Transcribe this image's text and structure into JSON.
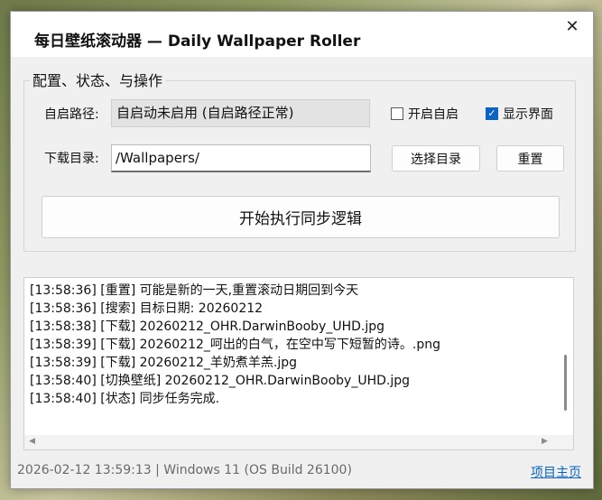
{
  "window": {
    "title": "每日壁纸滚动器 — Daily Wallpaper Roller",
    "close_glyph": "✕"
  },
  "config_group": {
    "title": "配置、状态、与操作",
    "autostart_label": "自启路径:",
    "autostart_value": "自启动未启用 (自启路径正常)",
    "enable_autostart": {
      "label": "开启自启",
      "checked": false
    },
    "show_ui": {
      "label": "显示界面",
      "checked": true
    },
    "download_label": "下载目录:",
    "download_value": "/Wallpapers/",
    "choose_dir_button": "选择目录",
    "reset_button": "重置",
    "run_button": "开始执行同步逻辑"
  },
  "log": {
    "lines": [
      "[13:58:36] [重置] 可能是新的一天,重置滚动日期回到今天",
      "[13:58:36] [搜索] 目标日期: 20260212",
      "[13:58:38] [下载] 20260212_OHR.DarwinBooby_UHD.jpg",
      "[13:58:39] [下载] 20260212_呵出的白气，在空中写下短暂的诗。.png",
      "[13:58:39] [下载] 20260212_羊奶煮羊羔.jpg",
      "[13:58:40] [切换壁纸] 20260212_OHR.DarwinBooby_UHD.jpg",
      "[13:58:40] [状态] 同步任务完成."
    ]
  },
  "statusbar": {
    "info": "2026-02-12 13:59:13 | Windows 11 (OS Build 26100)",
    "project_link": "项目主页"
  },
  "colors": {
    "accent": "#0a64c6",
    "window_bg": "#f0f0f0"
  }
}
